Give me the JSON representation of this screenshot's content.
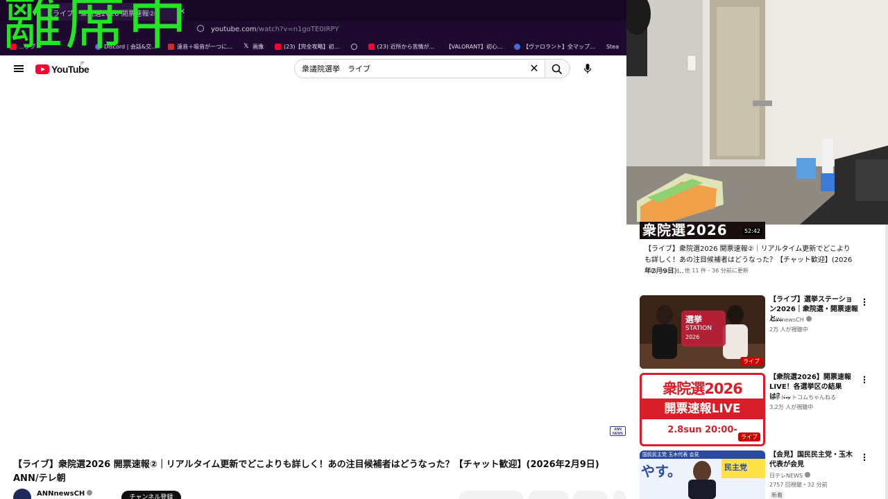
{
  "overlay": {
    "text": "離席中"
  },
  "browser": {
    "tab_title": "【ライブ】衆院選2026 開票速報②",
    "address_host": "youtube.com",
    "address_path": "/watch?v=n1goTE0IRPY",
    "bookmarks": [
      {
        "label": "…ップ",
        "icon": "youtube-icon"
      },
      {
        "label": "Discord | 会話&交…",
        "icon": "discord-icon"
      },
      {
        "label": "遠音＋吸音が一つに…",
        "icon": "bookmark-red-icon"
      },
      {
        "label": "画像",
        "icon": "x-icon"
      },
      {
        "label": "(23)【完全攻略】初…",
        "icon": "youtube-icon"
      },
      {
        "label": "",
        "icon": "globe-icon"
      },
      {
        "label": "(23) 近所から苦情が…",
        "icon": "youtube-icon"
      },
      {
        "label": "【VALORANT】初心…",
        "icon": "blank-icon"
      },
      {
        "label": "【ヴァロラント】全マップ…",
        "icon": "blue-circle-icon"
      },
      {
        "label": "Stea",
        "icon": "blank-icon"
      }
    ]
  },
  "header": {
    "logo_text": "YouTube",
    "region": "JP",
    "search_value": "衆議院選挙　ライブ"
  },
  "video": {
    "title": "【ライブ】衆院選2026 開票速報②｜リアルタイム更新でどこよりも詳しく！あの注目候補者はどうなった？【チャット歓迎】(2026年2月9日) ANN/テレ朝",
    "channel": "ANNnewsCH",
    "ann_badge_top": "ANN",
    "ann_badge_bottom": "NEWS",
    "subscribe_label": "チャンネル登録"
  },
  "sidebar": {
    "first": {
      "thumb_text": "衆院選2026",
      "duration": "52:42",
      "title": "【ライブ】衆院選2026 開票速報②｜リアルタイム更新でどこよりも詳しく！あの注目候補者はどうなった？【チャット歓迎】(2026年2月9日)…",
      "meta": "ANNnewsCH、他 11 件 - 36 分前に更新"
    },
    "items": [
      {
        "title": "【ライブ】選挙ステーション2026｜衆院選・開票速報 と…",
        "channel": "ANNnewsCH",
        "viewers": "2万 人が視聴中",
        "badge": "ライブ",
        "thumb_line1": "選挙",
        "thumb_line2": "STATION",
        "thumb_line3": "2026"
      },
      {
        "title": "【衆院選2026】開票速報LIVE！各選挙区の結果は？…",
        "channel": "選挙ドットコムちゃんねる",
        "viewers": "3.2万 人が視聴中",
        "badge": "ライブ",
        "thumb_line1": "衆院選2026",
        "thumb_line2": "開票速報LIVE",
        "thumb_line3": "2.8sun 20:00-"
      },
      {
        "title": "【会見】国民民主党・玉木代表が会見",
        "channel": "日テレNEWS",
        "viewers": "2757 回視聴・32 分前",
        "badge": "新着",
        "thumb_line1": "国民民主党 玉木代表 会見",
        "thumb_line2": "やす。",
        "thumb_line3": "民主党"
      }
    ]
  }
}
